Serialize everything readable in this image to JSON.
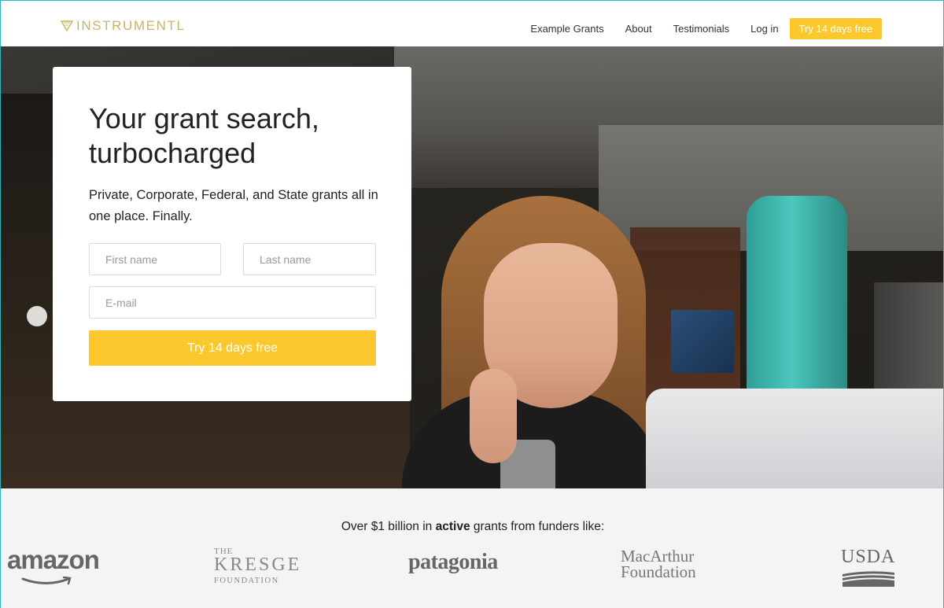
{
  "brand": {
    "name": "INSTRUMENTL",
    "accent": "#c8b469"
  },
  "nav": {
    "items": [
      "Example Grants",
      "About",
      "Testimonials",
      "Log in"
    ],
    "cta": "Try 14 days free",
    "cta_color": "#fcc82e"
  },
  "hero": {
    "title": "Your grant search, turbocharged",
    "subtitle": "Private, Corporate, Federal, and State grants all in one place. Finally.",
    "form": {
      "first_name_placeholder": "First name",
      "last_name_placeholder": "Last name",
      "email_placeholder": "E-mail",
      "submit": "Try 14 days free"
    }
  },
  "funders": {
    "text_before": "Over $1 billion in ",
    "text_bold": "active",
    "text_after": " grants from funders like:",
    "logos": {
      "amazon": "amazon",
      "kresge_the": "THE",
      "kresge_main": "KRESGE",
      "kresge_foundation": "FOUNDATION",
      "patagonia": "patagonia",
      "macarthur_line1": "MacArthur",
      "macarthur_line2": "Foundation",
      "usda": "USDA"
    }
  }
}
